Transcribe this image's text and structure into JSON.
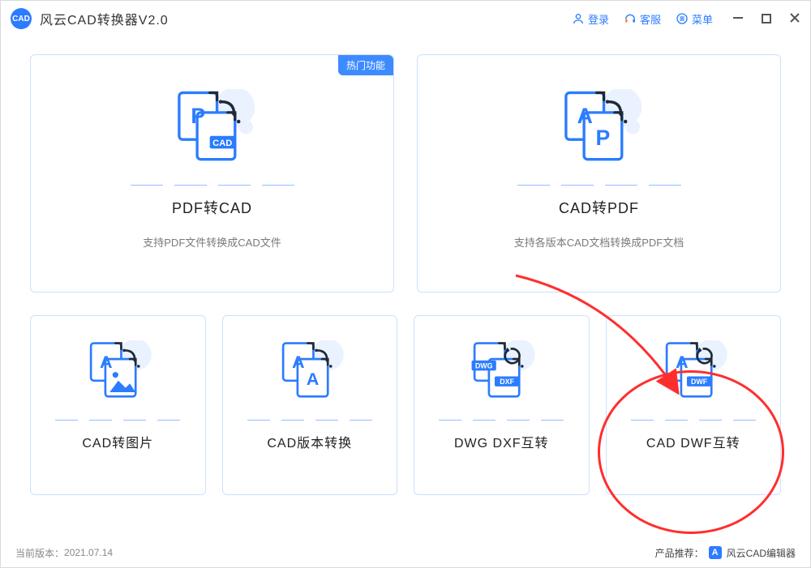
{
  "titlebar": {
    "app_title": "风云CAD转换器V2.0",
    "nav": {
      "login": "登录",
      "support": "客服",
      "menu": "菜单"
    }
  },
  "cards": {
    "pdf2cad": {
      "badge": "热门功能",
      "title": "PDF转CAD",
      "sub": "支持PDF文件转换成CAD文件"
    },
    "cad2pdf": {
      "title": "CAD转PDF",
      "sub": "支持各版本CAD文档转换成PDF文档"
    },
    "cad2img": {
      "title": "CAD转图片"
    },
    "cadver": {
      "title": "CAD版本转换"
    },
    "dwgdxf": {
      "title": "DWG DXF互转"
    },
    "caddwf": {
      "title": "CAD DWF互转"
    }
  },
  "footer": {
    "version_label": "当前版本：",
    "version_value": "2021.07.14",
    "promo_label": "产品推荐：",
    "promo_name": "风云CAD编辑器"
  }
}
